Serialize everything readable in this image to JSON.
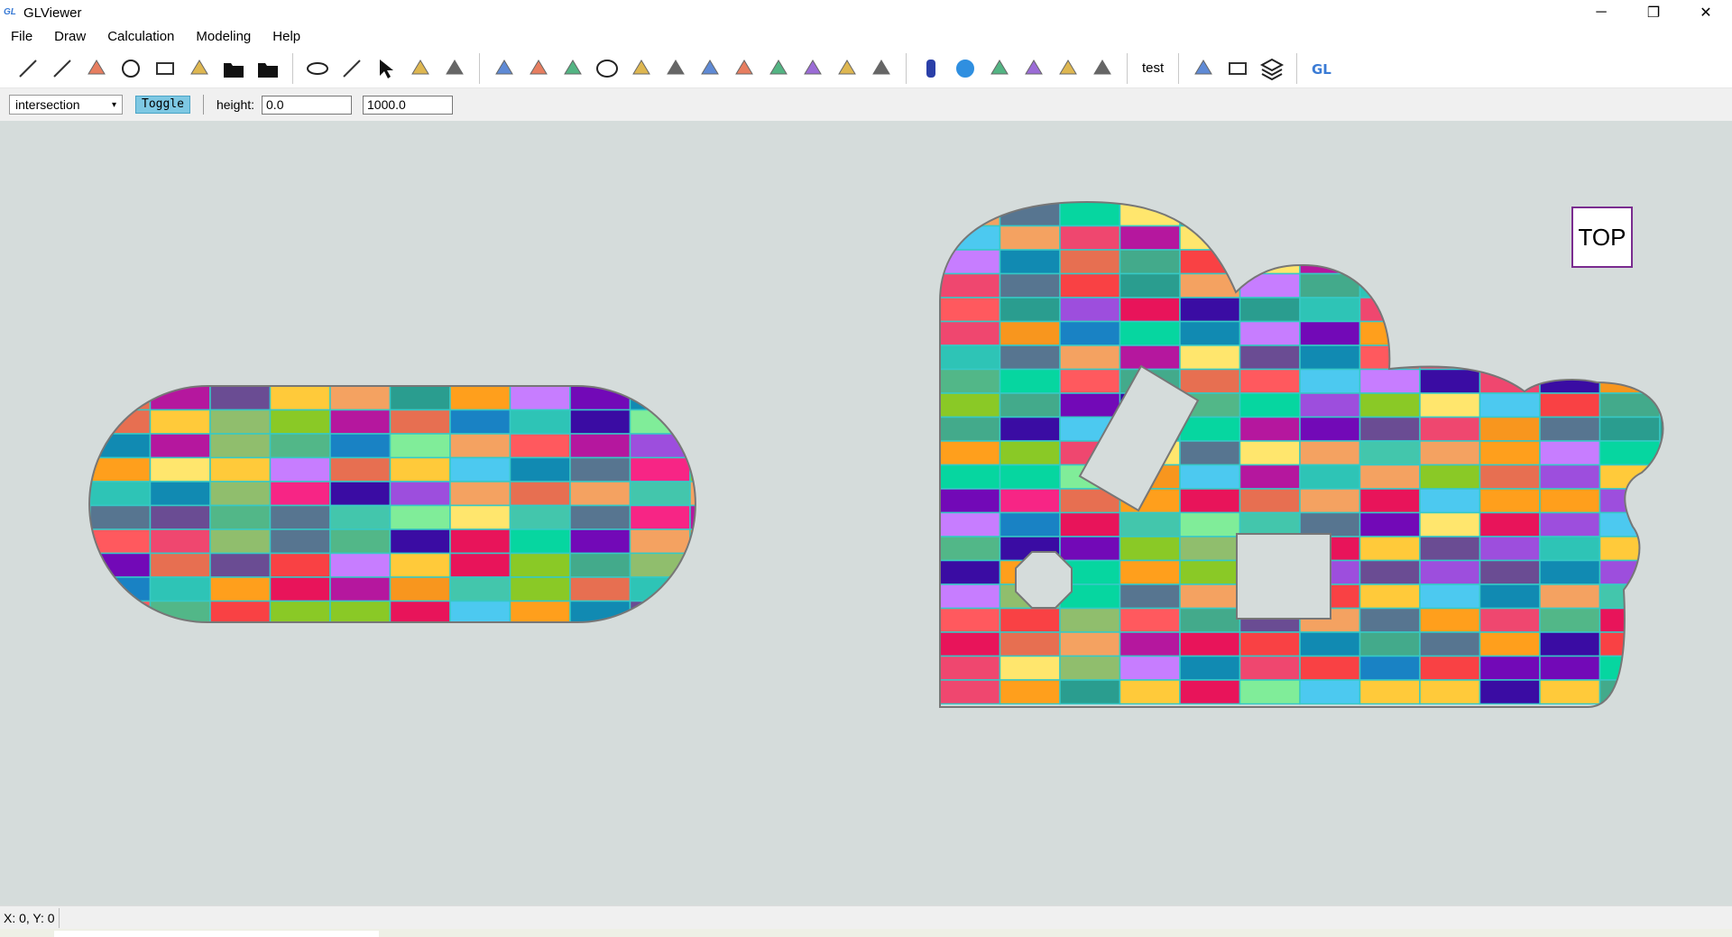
{
  "window": {
    "title": "GLViewer",
    "logo": "GL",
    "controls": {
      "minimize": "─",
      "maximize": "❐",
      "close": "✕"
    }
  },
  "menu": [
    "File",
    "Draw",
    "Calculation",
    "Modeling",
    "Help"
  ],
  "toolbar": {
    "groups": [
      [
        "line-icon",
        "polyline-icon",
        "arc-icon",
        "circle-icon",
        "rectangle-icon",
        "emoji-icon",
        "open-folder-icon",
        "save-icon"
      ],
      [
        "eye-icon",
        "eye-outline-icon",
        "pointer-icon",
        "layer-copy-icon",
        "trash-icon"
      ],
      [
        "shape-fill-icon",
        "triangle-mesh-icon",
        "polygon-icon",
        "ellipse-icon",
        "cloud-shape-icon",
        "cake-icon",
        "boolean-union-icon",
        "boolean-subtract-icon",
        "boolean-intersect-icon",
        "boolean-xor-icon",
        "texture-icon",
        "brush-icon"
      ],
      [
        "cylinder-icon",
        "sphere-icon",
        "extrude-icon",
        "solid-icon",
        "solid-cut-icon",
        "texture-solid-icon"
      ]
    ],
    "test_label": "test",
    "tail": [
      "work-plane-icon",
      "cube-icon",
      "layers-icon",
      "gl-logo-icon"
    ]
  },
  "options": {
    "mode": "intersection",
    "toggle_label": "Toggle",
    "height_label": "height:",
    "height_min": "0.0",
    "height_max": "1000.0"
  },
  "viewport": {
    "view_label": "TOP"
  },
  "status": {
    "coords": "X: 0, Y: 0"
  }
}
